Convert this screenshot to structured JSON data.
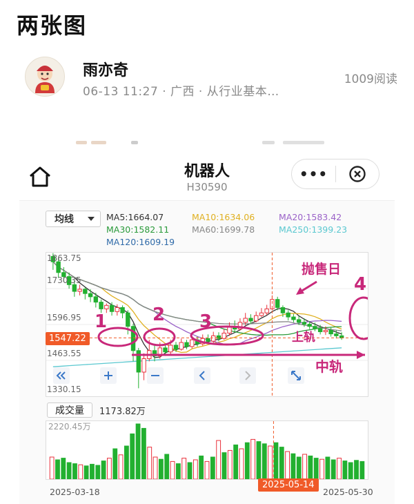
{
  "post": {
    "title": "两张图",
    "author": "雨亦奇",
    "meta": "06-13 11:27 · 广西 · 从行业基本…",
    "reads": "1009阅读"
  },
  "screenshot": {
    "stock_name": "机器人",
    "stock_code": "H30590",
    "capsule_more": "•••",
    "ma_select": "均线",
    "ma_values": {
      "ma5": "MA5:1664.07",
      "ma10": "MA10:1634.06",
      "ma20": "MA20:1583.42",
      "ma30": "MA30:1582.11",
      "ma60": "MA60:1699.78",
      "ma250": "MA250:1399.23",
      "ma120": "MA120:1609.19"
    },
    "ma_colors": {
      "ma5": "#333333",
      "ma10": "#e0b020",
      "ma20": "#9a62c8",
      "ma30": "#2a9a3a",
      "ma60": "#888888",
      "ma250": "#5ac8d0",
      "ma120": "#2f6aa8"
    },
    "price_ticks": [
      "1863.75",
      "1730.35",
      "1596.95",
      "1463.55",
      "1330.15"
    ],
    "current_price": "1547.22",
    "volume_button": "成交量",
    "volume_value": "1173.82万",
    "volume_top": "2220.45万",
    "dates": {
      "start": "2025-03-18",
      "highlight": "2025-05-14",
      "end": "2025-05-30"
    },
    "nav_icons": [
      "double-left-icon",
      "zoom-in-icon",
      "zoom-out-icon",
      "left-icon",
      "right-icon",
      "fullscreen-icon"
    ],
    "annotations": {
      "n1": "1",
      "n2": "2",
      "n3": "3",
      "n4": "4",
      "sell_day": "抛售日",
      "upper_rail": "上轨",
      "middle_rail": "中轨"
    },
    "colors": {
      "up": "#e8303a",
      "down": "#22b030",
      "accent": "#f05a28",
      "annotation": "#c8287a"
    },
    "chart_data": {
      "type": "candlestick",
      "x_start": "2025-03-18",
      "x_end": "2025-05-30",
      "ylim": [
        1330.15,
        1863.75
      ],
      "candles": [
        [
          1850,
          1830,
          1862,
          1800
        ],
        [
          1830,
          1790,
          1845,
          1770
        ],
        [
          1790,
          1775,
          1810,
          1755
        ],
        [
          1775,
          1745,
          1790,
          1730
        ],
        [
          1745,
          1720,
          1760,
          1700
        ],
        [
          1720,
          1728,
          1745,
          1705
        ],
        [
          1728,
          1712,
          1735,
          1690
        ],
        [
          1712,
          1700,
          1728,
          1680
        ],
        [
          1700,
          1680,
          1715,
          1660
        ],
        [
          1680,
          1655,
          1690,
          1640
        ],
        [
          1655,
          1668,
          1675,
          1640
        ],
        [
          1668,
          1645,
          1680,
          1630
        ],
        [
          1645,
          1660,
          1672,
          1630
        ],
        [
          1660,
          1640,
          1668,
          1620
        ],
        [
          1640,
          1590,
          1650,
          1560
        ],
        [
          1590,
          1500,
          1600,
          1460
        ],
        [
          1500,
          1420,
          1510,
          1360
        ],
        [
          1420,
          1470,
          1490,
          1390
        ],
        [
          1470,
          1500,
          1540,
          1460
        ],
        [
          1500,
          1480,
          1520,
          1460
        ],
        [
          1480,
          1510,
          1530,
          1470
        ],
        [
          1510,
          1495,
          1520,
          1480
        ],
        [
          1495,
          1520,
          1540,
          1485
        ],
        [
          1520,
          1505,
          1532,
          1495
        ],
        [
          1505,
          1530,
          1545,
          1500
        ],
        [
          1530,
          1515,
          1540,
          1505
        ],
        [
          1515,
          1540,
          1556,
          1508
        ],
        [
          1540,
          1525,
          1552,
          1515
        ],
        [
          1525,
          1545,
          1560,
          1518
        ],
        [
          1545,
          1535,
          1560,
          1525
        ],
        [
          1535,
          1555,
          1570,
          1528
        ],
        [
          1555,
          1545,
          1568,
          1535
        ],
        [
          1545,
          1565,
          1580,
          1540
        ],
        [
          1565,
          1590,
          1605,
          1555
        ],
        [
          1590,
          1580,
          1612,
          1570
        ],
        [
          1580,
          1605,
          1620,
          1575
        ],
        [
          1605,
          1620,
          1640,
          1595
        ],
        [
          1620,
          1610,
          1635,
          1600
        ],
        [
          1610,
          1630,
          1645,
          1605
        ],
        [
          1630,
          1640,
          1658,
          1625
        ],
        [
          1640,
          1655,
          1670,
          1632
        ],
        [
          1655,
          1690,
          1705,
          1650
        ],
        [
          1690,
          1660,
          1700,
          1650
        ],
        [
          1660,
          1640,
          1668,
          1625
        ],
        [
          1640,
          1625,
          1650,
          1612
        ],
        [
          1625,
          1615,
          1636,
          1605
        ],
        [
          1615,
          1605,
          1628,
          1595
        ],
        [
          1605,
          1598,
          1620,
          1588
        ],
        [
          1598,
          1590,
          1610,
          1580
        ],
        [
          1590,
          1582,
          1604,
          1572
        ],
        [
          1582,
          1570,
          1595,
          1560
        ],
        [
          1570,
          1575,
          1590,
          1558
        ],
        [
          1575,
          1562,
          1585,
          1552
        ],
        [
          1562,
          1555,
          1575,
          1545
        ],
        [
          1555,
          1547,
          1568,
          1540
        ]
      ],
      "volumes": [
        [
          40,
          0
        ],
        [
          35,
          1
        ],
        [
          38,
          1
        ],
        [
          30,
          1
        ],
        [
          28,
          1
        ],
        [
          26,
          0
        ],
        [
          24,
          1
        ],
        [
          27,
          1
        ],
        [
          25,
          1
        ],
        [
          33,
          1
        ],
        [
          38,
          0
        ],
        [
          55,
          1
        ],
        [
          44,
          0
        ],
        [
          60,
          1
        ],
        [
          82,
          1
        ],
        [
          100,
          1
        ],
        [
          92,
          1
        ],
        [
          58,
          0
        ],
        [
          40,
          0
        ],
        [
          36,
          1
        ],
        [
          45,
          1
        ],
        [
          32,
          0
        ],
        [
          28,
          1
        ],
        [
          38,
          0
        ],
        [
          30,
          1
        ],
        [
          35,
          0
        ],
        [
          42,
          1
        ],
        [
          32,
          0
        ],
        [
          40,
          1
        ],
        [
          70,
          0
        ],
        [
          48,
          1
        ],
        [
          52,
          0
        ],
        [
          62,
          1
        ],
        [
          55,
          0
        ],
        [
          66,
          1
        ],
        [
          72,
          0
        ],
        [
          68,
          1
        ],
        [
          64,
          1
        ],
        [
          60,
          0
        ],
        [
          66,
          1
        ],
        [
          58,
          1
        ],
        [
          50,
          0
        ],
        [
          46,
          1
        ],
        [
          40,
          1
        ],
        [
          45,
          0
        ],
        [
          42,
          1
        ],
        [
          38,
          1
        ],
        [
          36,
          0
        ],
        [
          40,
          1
        ],
        [
          35,
          1
        ],
        [
          38,
          0
        ],
        [
          33,
          1
        ],
        [
          30,
          1
        ],
        [
          34,
          1
        ],
        [
          32,
          1
        ]
      ]
    }
  }
}
